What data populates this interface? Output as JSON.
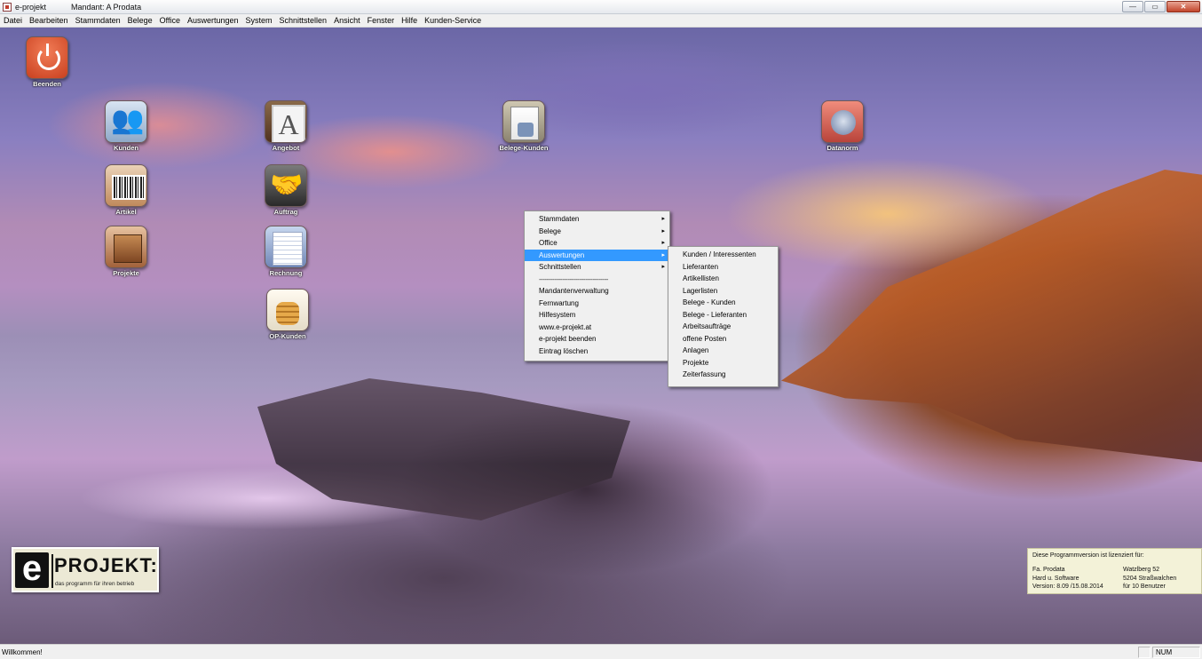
{
  "window": {
    "title": "e-projekt",
    "mandant": "Mandant:  A  Prodata",
    "controls": {
      "minimize": "—",
      "restore": "▭",
      "close": "✕"
    }
  },
  "menubar": [
    "Datei",
    "Bearbeiten",
    "Stammdaten",
    "Belege",
    "Office",
    "Auswertungen",
    "System",
    "Schnittstellen",
    "Ansicht",
    "Fenster",
    "Hilfe",
    "Kunden-Service"
  ],
  "desktop_icons": {
    "beenden": "Beenden",
    "kunden": "Kunden",
    "artikel": "Artikel",
    "projekte": "Projekte",
    "angebot": "Angebot",
    "auftrag": "Auftrag",
    "rechnung": "Rechnung",
    "op_kunden": "OP-Kunden",
    "belege_kunden": "Belege-Kunden",
    "datanorm": "Datanorm"
  },
  "context_menu": {
    "items": [
      {
        "label": "Stammdaten",
        "submenu": true
      },
      {
        "label": "Belege",
        "submenu": true
      },
      {
        "label": "Office",
        "submenu": true
      },
      {
        "label": "Auswertungen",
        "submenu": true,
        "active": true
      },
      {
        "label": "Schnittstellen",
        "submenu": true
      }
    ],
    "separator": "------------------------------------",
    "items2": [
      "Mandantenverwaltung",
      "Fernwartung",
      "Hilfesystem",
      "www.e-projekt.at",
      "e-projekt beenden",
      "Eintrag löschen"
    ],
    "arrow": "▸"
  },
  "submenu_auswertungen": [
    "Kunden / Interessenten",
    "Lieferanten",
    "Artikellisten",
    "Lagerlisten",
    "Belege - Kunden",
    "Belege - Lieferanten",
    "Arbeitsaufträge",
    "offene Posten",
    "Anlagen",
    "Projekte",
    "Zeiterfassung"
  ],
  "logo": {
    "letter": "e",
    "word": "PROJEKT:",
    "tagline": "das programm für ihren betrieb"
  },
  "license": {
    "heading": "Diese Programmversion ist lizenziert für:",
    "left": [
      "Fa. Prodata",
      "Hard u. Software",
      "Version: 8.09 /15.08.2014"
    ],
    "right": [
      "Watzlberg 52",
      "5204 Straßwalchen",
      "für 10 Benutzer"
    ]
  },
  "statusbar": {
    "text": "Willkommen!",
    "pane1": "",
    "pane2": "NUM"
  },
  "colors": {
    "menu_highlight": "#3399ff",
    "close_button": "#c2452b"
  }
}
